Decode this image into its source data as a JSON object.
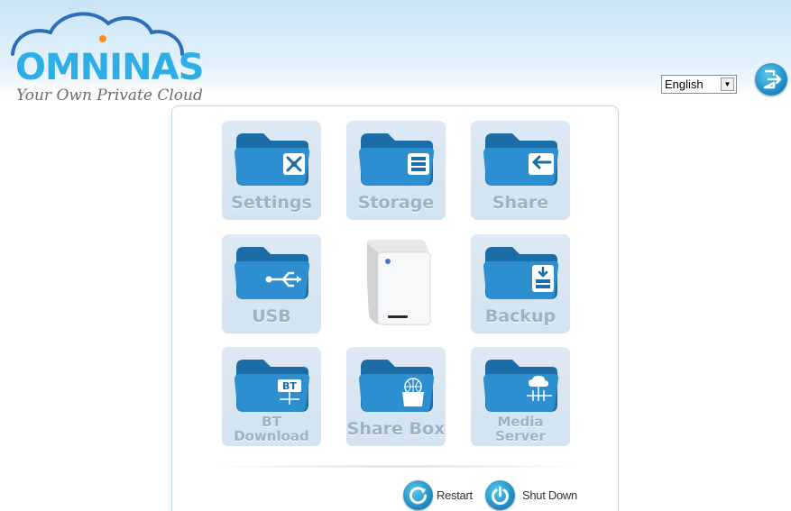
{
  "header": {
    "logo_text": "OMNINAS",
    "tagline": "Your Own Private Cloud"
  },
  "language_select": {
    "value": "English"
  },
  "tiles": [
    {
      "label": "Settings",
      "icon": "tools-icon"
    },
    {
      "label": "Storage",
      "icon": "storage-stack-icon"
    },
    {
      "label": "Share",
      "icon": "share-arrows-icon"
    },
    {
      "label": "USB",
      "icon": "usb-icon"
    },
    {
      "label": "Backup",
      "icon": "backup-download-icon"
    },
    {
      "label": "BT Download",
      "line1": "BT",
      "line2": "Download",
      "icon": "bt-icon"
    },
    {
      "label": "Share Box",
      "icon": "globe-box-icon"
    },
    {
      "label": "Media Server",
      "line1": "Media",
      "line2": "Server",
      "icon": "cloud-network-icon"
    }
  ],
  "actions": {
    "restart_label": "Restart",
    "shutdown_label": "Shut Down"
  },
  "colors": {
    "brand": "#2eaee6",
    "tile_bg": "#d3e3f1",
    "tile_label": "#9cb2c5",
    "button": "#1d84bd"
  }
}
